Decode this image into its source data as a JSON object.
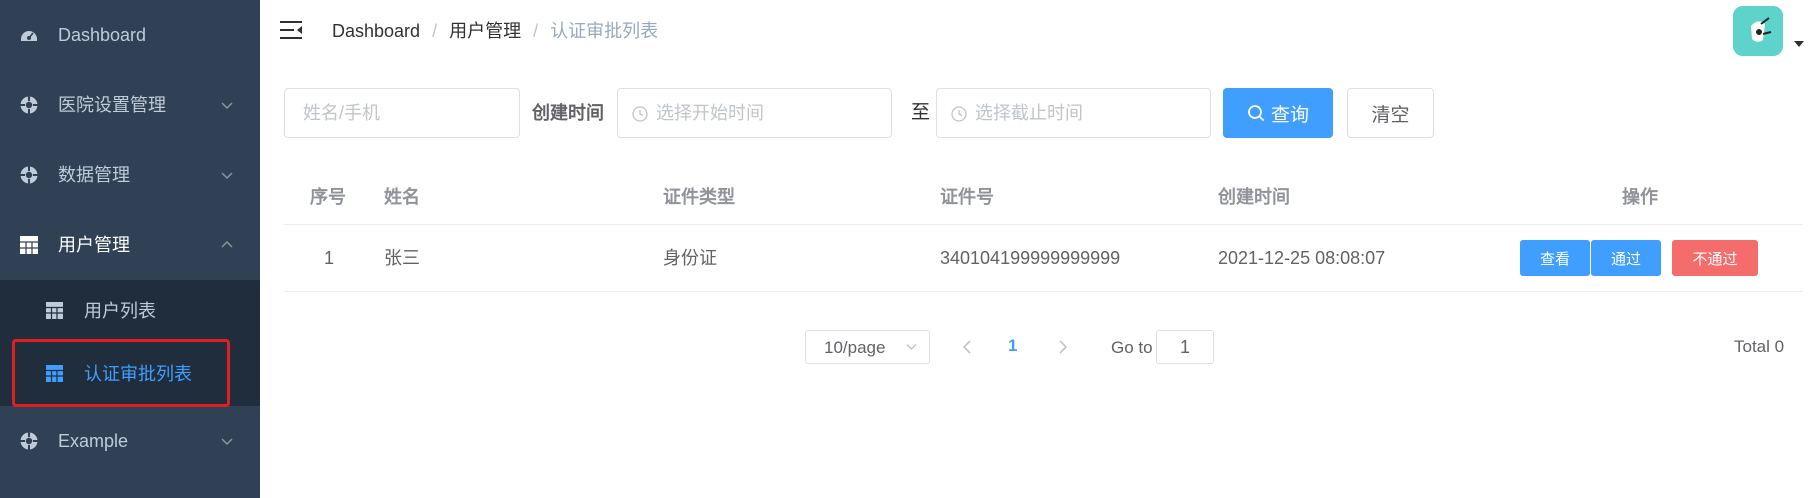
{
  "sidebar": {
    "items": [
      {
        "label": "Dashboard",
        "icon": "dashboard-icon"
      },
      {
        "label": "医院设置管理",
        "icon": "settings-circle-icon",
        "arrow": "chevron-down-icon"
      },
      {
        "label": "数据管理",
        "icon": "settings-circle-icon",
        "arrow": "chevron-down-icon"
      },
      {
        "label": "用户管理",
        "icon": "table-icon",
        "arrow": "chevron-up-icon"
      },
      {
        "label": "Example",
        "icon": "settings-circle-icon",
        "arrow": "chevron-down-icon"
      }
    ],
    "submenu": [
      {
        "label": "用户列表",
        "icon": "table-icon"
      },
      {
        "label": "认证审批列表",
        "icon": "table-icon",
        "active": true
      }
    ]
  },
  "header": {
    "breadcrumb": [
      "Dashboard",
      "用户管理",
      "认证审批列表"
    ],
    "separator": "/"
  },
  "search": {
    "name_placeholder": "姓名/手机",
    "created_label": "创建时间",
    "start_placeholder": "选择开始时间",
    "range_separator": "至",
    "end_placeholder": "选择截止时间",
    "query_label": "查询",
    "clear_label": "清空"
  },
  "table": {
    "columns": [
      "序号",
      "姓名",
      "证件类型",
      "证件号",
      "创建时间",
      "操作"
    ],
    "rows": [
      {
        "index": "1",
        "name": "张三",
        "cert_type": "身份证",
        "cert_no": "340104199999999999",
        "created": "2021-12-25 08:08:07"
      }
    ],
    "actions": {
      "view": "查看",
      "approve": "通过",
      "reject": "不通过"
    }
  },
  "pagination": {
    "page_size": "10/page",
    "current_page": "1",
    "goto_label": "Go to",
    "goto_value": "1",
    "total": "Total 0"
  },
  "colors": {
    "sidebar_bg": "#304156",
    "submenu_bg": "#1f2d3d",
    "primary": "#409eff",
    "danger": "#f56c6c",
    "avatar_bg": "#5dd3cc",
    "highlight": "#e02020"
  }
}
